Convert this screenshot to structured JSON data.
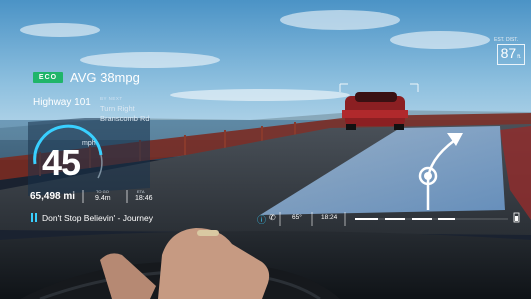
{
  "hud": {
    "eco_badge": "ECO",
    "avg_mpg": "AVG 38mpg",
    "route": "Highway 101",
    "nav": {
      "sub": "BY NEXT",
      "turn": "Turn Right",
      "street": "Branscomb Rd"
    },
    "speed": {
      "value": "45",
      "unit": "mph"
    },
    "odometer": "65,498 mi",
    "stats": [
      {
        "label": "TO GO",
        "value": "9.4m"
      },
      {
        "label": "ETA",
        "value": "18:46"
      }
    ],
    "media": {
      "now_playing": "Don't Stop Believin' - Journey"
    },
    "est_dist": {
      "label": "EST. DIST.",
      "value": "87",
      "unit": "ft."
    },
    "status": {
      "temperature": "65°",
      "clock": "18:24"
    }
  },
  "colors": {
    "accent_cyan": "#39d0ff",
    "eco_green": "#1fb56a",
    "lane_blue": "#9cc0e6"
  }
}
